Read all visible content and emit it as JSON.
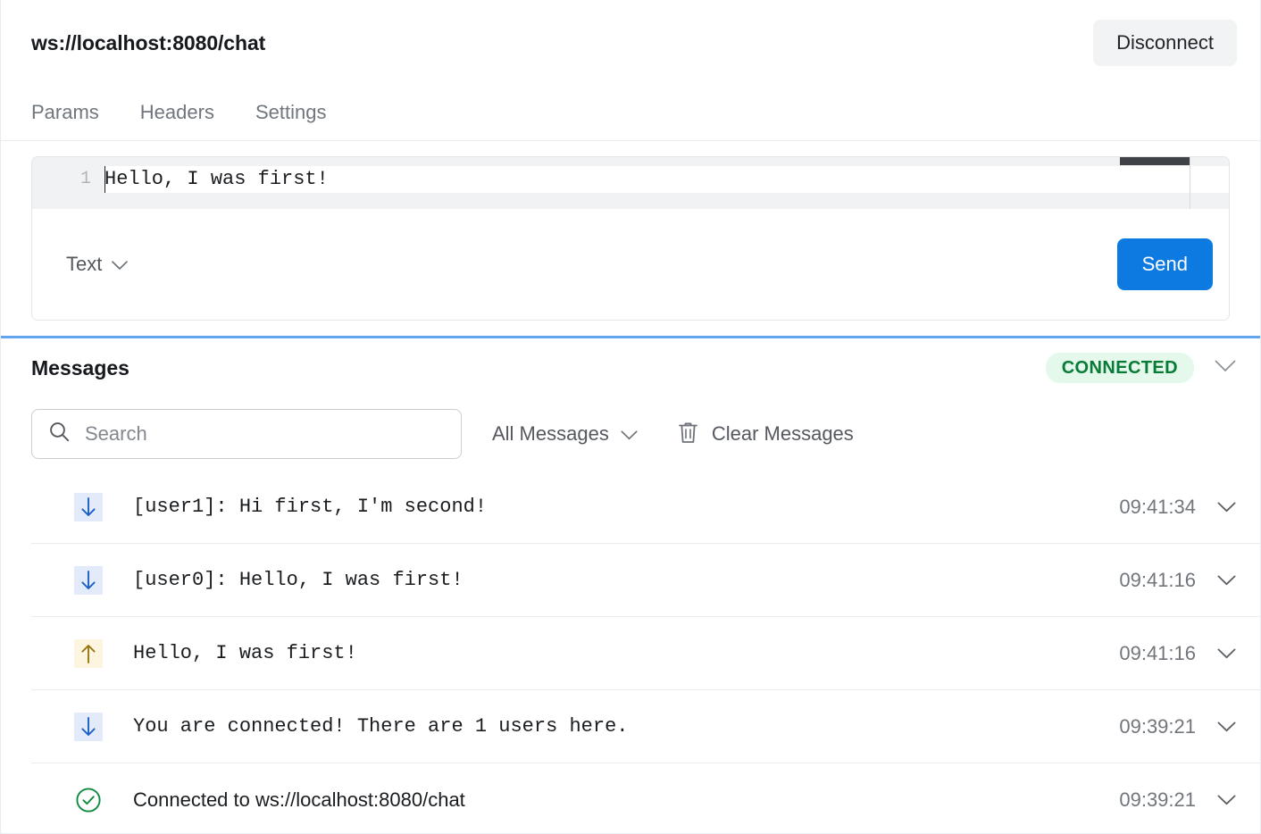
{
  "header": {
    "url": "ws://localhost:8080/chat",
    "disconnect_label": "Disconnect"
  },
  "tabs": [
    {
      "label": "Params"
    },
    {
      "label": "Headers"
    },
    {
      "label": "Settings"
    }
  ],
  "composer": {
    "line_number": "1",
    "content": "Hello, I was first!",
    "format_label": "Text",
    "send_label": "Send"
  },
  "messages_panel": {
    "title": "Messages",
    "status": "CONNECTED",
    "search_placeholder": "Search",
    "search_value": "",
    "filter_label": "All Messages",
    "clear_label": "Clear Messages",
    "rows": [
      {
        "direction": "in",
        "icon": "arrow-down-icon",
        "text": "[user1]: Hi first, I'm second!",
        "time": "09:41:34",
        "mono": true
      },
      {
        "direction": "in",
        "icon": "arrow-down-icon",
        "text": "[user0]: Hello, I was first!",
        "time": "09:41:16",
        "mono": true
      },
      {
        "direction": "out",
        "icon": "arrow-up-icon",
        "text": "Hello, I was first!",
        "time": "09:41:16",
        "mono": true
      },
      {
        "direction": "in",
        "icon": "arrow-down-icon",
        "text": "You are connected! There are 1 users here.",
        "time": "09:39:21",
        "mono": true
      },
      {
        "direction": "sys",
        "icon": "check-circle-icon",
        "text": "Connected to ws://localhost:8080/chat",
        "time": "09:39:21",
        "mono": false
      }
    ]
  },
  "colors": {
    "accent_blue": "#0d7ae2",
    "panel_divider_blue": "#63a4ee",
    "status_green_text": "#087c36",
    "status_green_bg": "#e4f8ec",
    "incoming_arrow": "#1a5fc8",
    "incoming_bg": "#e3ebfa",
    "outgoing_arrow": "#9a7512",
    "outgoing_bg": "#fdf5e0",
    "system_green": "#0f8a3c"
  }
}
